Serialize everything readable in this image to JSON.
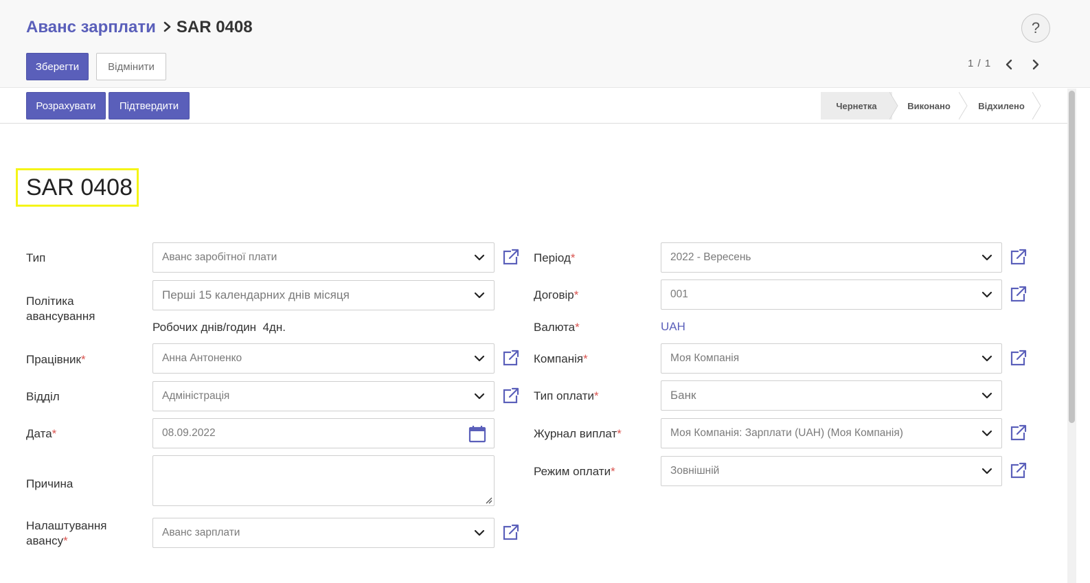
{
  "header": {
    "breadcrumb_parent": "Аванс зарплати",
    "breadcrumb_current": "SAR 0408",
    "help_label": "?"
  },
  "toolbar": {
    "save_label": "Зберегти",
    "discard_label": "Відмінити",
    "pager": "1 / 1"
  },
  "actions": {
    "compute_label": "Розрахувати",
    "confirm_label": "Підтвердити"
  },
  "statusbar": {
    "stages": [
      "Чернетка",
      "Виконано",
      "Відхилено"
    ],
    "active": "Чернетка"
  },
  "record": {
    "title": "SAR 0408"
  },
  "form": {
    "left": {
      "type_label": "Тип",
      "type_value": "Аванс заробітної плати",
      "policy_label_line1": "Політика",
      "policy_label_line2": "авансування",
      "policy_value": "Перші 15 календарних днів місяця",
      "workdays_label": "Робочих днів/годин",
      "workdays_value": "4дн.",
      "employee_label": "Працівник",
      "employee_value": "Анна Антоненко",
      "department_label": "Відділ",
      "department_value": "Адміністрація",
      "date_label": "Дата",
      "date_value": "08.09.2022",
      "reason_label": "Причина",
      "reason_value": "",
      "settings_label_line1": "Налаштування",
      "settings_label_line2": "авансу",
      "settings_value": "Аванс зарплати"
    },
    "right": {
      "period_label": "Період",
      "period_value": "2022 - Вересень",
      "contract_label": "Договір",
      "contract_value": "001",
      "currency_label": "Валюта",
      "currency_value": "UAH",
      "company_label": "Компанія",
      "company_value": "Моя Компанія",
      "payment_type_label": "Тип оплати",
      "payment_type_value": "Банк",
      "journal_label": "Журнал виплат",
      "journal_value": "Моя Компанія: Зарплати (UAH) (Моя Компанія)",
      "payment_mode_label": "Режим оплати",
      "payment_mode_value": "Зовнішній"
    },
    "required_mark": "*"
  },
  "colors": {
    "primary": "#5a5fba",
    "required": "#d9534f",
    "highlight": "#f5f517"
  }
}
